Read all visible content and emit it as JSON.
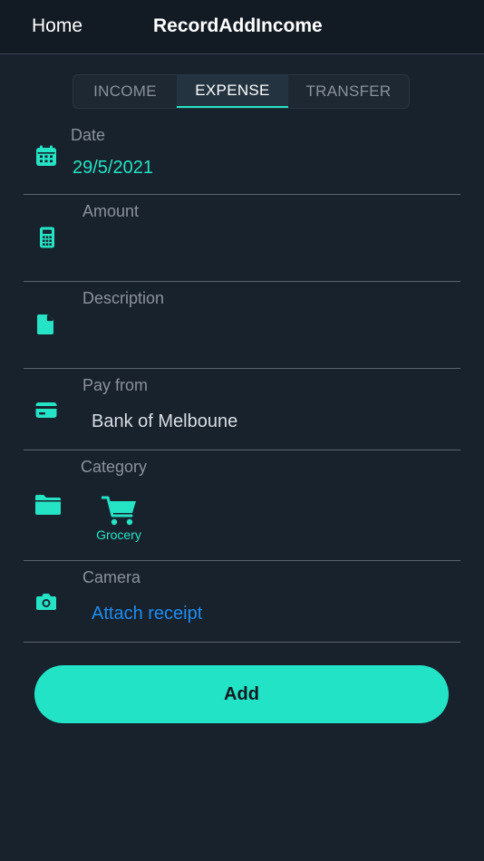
{
  "nav": {
    "back_label": "Home",
    "title": "RecordAddIncome"
  },
  "tabs": [
    {
      "label": "INCOME",
      "selected": false
    },
    {
      "label": "EXPENSE",
      "selected": true
    },
    {
      "label": "TRANSFER",
      "selected": false
    }
  ],
  "form": {
    "date": {
      "label": "Date",
      "value": "29/5/2021",
      "icon": "calendar-icon"
    },
    "amount": {
      "label": "Amount",
      "value": "",
      "icon": "calculator-icon"
    },
    "description": {
      "label": "Description",
      "value": "",
      "icon": "document-icon"
    },
    "pay_from": {
      "label": "Pay from",
      "value": "Bank of Melboune",
      "icon": "credit-card-icon"
    },
    "category": {
      "label": "Category",
      "value": "Grocery",
      "icon": "folder-icon",
      "item_icon": "shopping-cart-icon"
    },
    "camera": {
      "label": "Camera",
      "action": "Attach receipt",
      "icon": "camera-icon"
    }
  },
  "add_button": {
    "label": "Add"
  },
  "colors": {
    "background": "#18222d",
    "accent": "#25e3c5",
    "link": "#1e8cf0",
    "label": "#8a929b",
    "value": "#d8dde3"
  }
}
